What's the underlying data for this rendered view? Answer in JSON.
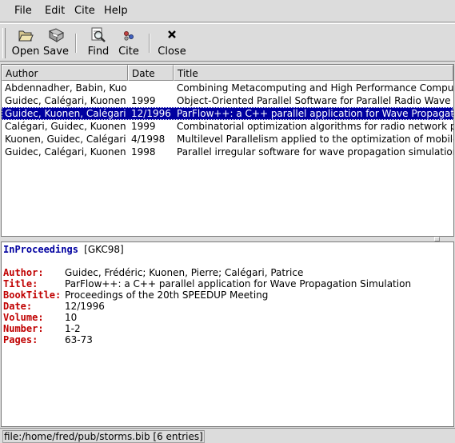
{
  "menu": [
    "File",
    "Edit",
    "Cite",
    "Help"
  ],
  "toolbar": {
    "open": "Open",
    "save": "Save",
    "find": "Find",
    "cite": "Cite",
    "close": "Close"
  },
  "columns": [
    "Author",
    "Date",
    "Title"
  ],
  "entries": [
    {
      "author": "Abdennadher, Babin, Kuonen",
      "date": "",
      "title": "Combining Metacomputing and High Performance Computing"
    },
    {
      "author": "Guidec, Calégari, Kuonen,",
      "date": "1999",
      "title": "Object-Oriented Parallel Software for Parallel Radio Wave Propagation"
    },
    {
      "author": "Guidec, Kuonen, Calégari",
      "date": "12/1996",
      "title": "ParFlow++: a C++ parallel application for Wave Propagation Simulation"
    },
    {
      "author": "Calégari, Guidec, Kuonen,",
      "date": "1999",
      "title": "Combinatorial optimization algorithms for radio network planning"
    },
    {
      "author": "Kuonen, Guidec, Calégari",
      "date": "4/1998",
      "title": "Multilevel Parallelism applied to the optimization of mobile networks"
    },
    {
      "author": "Guidec, Calégari, Kuonen",
      "date": "1998",
      "title": "Parallel irregular software for wave propagation simulation"
    }
  ],
  "selected_index": 2,
  "detail": {
    "type": "InProceedings",
    "key": "[GKC98]",
    "fields": [
      {
        "name": "Author:",
        "value": "Guidec, Frédéric; Kuonen, Pierre; Calégari, Patrice"
      },
      {
        "name": "Title:",
        "value": "ParFlow++: a C++ parallel application for Wave Propagation Simulation"
      },
      {
        "name": "BookTitle:",
        "value": "Proceedings of the 20th SPEEDUP Meeting"
      },
      {
        "name": "Date:",
        "value": "12/1996"
      },
      {
        "name": "Volume:",
        "value": "10"
      },
      {
        "name": "Number:",
        "value": "1-2"
      },
      {
        "name": "Pages:",
        "value": "63-73"
      }
    ]
  },
  "status": "file:/home/fred/pub/storms.bib [6 entries]",
  "colors": {
    "selection": "#0000a0",
    "field_name": "#c00000",
    "entry_type": "#0000a0"
  }
}
